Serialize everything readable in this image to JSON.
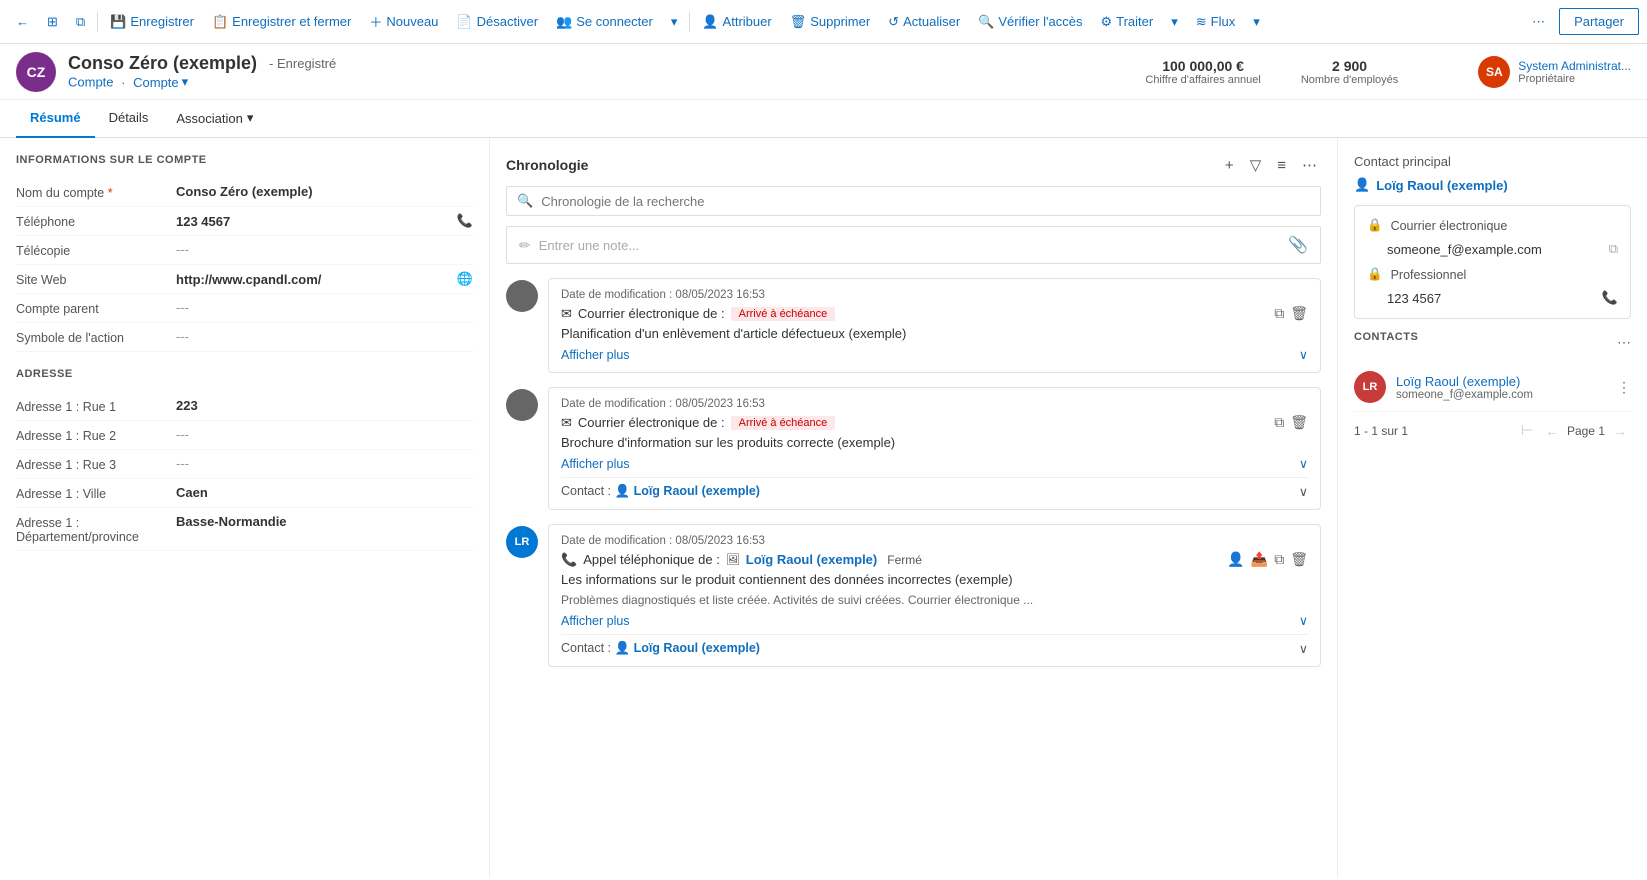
{
  "toolbar": {
    "back_icon": "←",
    "grid_icon": "⊞",
    "window_icon": "⧉",
    "save_label": "Enregistrer",
    "save_close_label": "Enregistrer et fermer",
    "new_label": "Nouveau",
    "deactivate_label": "Désactiver",
    "connect_label": "Se connecter",
    "connect_dropdown": "▾",
    "assign_label": "Attribuer",
    "delete_label": "Supprimer",
    "refresh_label": "Actualiser",
    "verify_label": "Vérifier l'accès",
    "process_label": "Traiter",
    "process_dropdown": "▾",
    "flux_label": "Flux",
    "flux_dropdown": "▾",
    "more_icon": "⋯",
    "share_label": "Partager"
  },
  "record": {
    "initials": "CZ",
    "name": "Conso Zéro (exemple)",
    "status": "- Enregistré",
    "breadcrumb1": "Compte",
    "breadcrumb2": "Compte",
    "kpi1_value": "100 000,00 €",
    "kpi1_label": "Chiffre d'affaires annuel",
    "kpi2_value": "2 900",
    "kpi2_label": "Nombre d'employés",
    "owner_initials": "SA",
    "owner_name": "System Administrat...",
    "owner_label": "Propriétaire"
  },
  "tabs": {
    "tab1": "Résumé",
    "tab2": "Détails",
    "tab3": "Association"
  },
  "account_info": {
    "section_title": "INFORMATIONS SUR LE COMPTE",
    "fields": [
      {
        "label": "Nom du compte",
        "required": true,
        "value": "Conso Zéro (exemple)",
        "empty": false
      },
      {
        "label": "Téléphone",
        "required": false,
        "value": "123 4567",
        "empty": false,
        "icon": "📞"
      },
      {
        "label": "Télécopie",
        "required": false,
        "value": "---",
        "empty": true
      },
      {
        "label": "Site Web",
        "required": false,
        "value": "http://www.cpandl.com/",
        "empty": false,
        "icon": "🌐"
      },
      {
        "label": "Compte parent",
        "required": false,
        "value": "---",
        "empty": true
      },
      {
        "label": "Symbole de l'action",
        "required": false,
        "value": "---",
        "empty": true
      }
    ]
  },
  "address": {
    "section_title": "ADRESSE",
    "fields": [
      {
        "label": "Adresse 1 : Rue 1",
        "value": "223",
        "empty": false
      },
      {
        "label": "Adresse 1 : Rue 2",
        "value": "---",
        "empty": true
      },
      {
        "label": "Adresse 1 : Rue 3",
        "value": "---",
        "empty": true
      },
      {
        "label": "Adresse 1 : Ville",
        "value": "Caen",
        "empty": false
      },
      {
        "label": "Adresse 1 : Département/province",
        "value": "Basse-Normandie",
        "empty": false
      }
    ]
  },
  "timeline": {
    "title": "Chronologie",
    "search_placeholder": "Chronologie de la recherche",
    "note_placeholder": "Entrer une note...",
    "add_icon": "+",
    "filter_icon": "⛁",
    "list_icon": "≡",
    "more_icon": "⋯",
    "entries": [
      {
        "id": 1,
        "avatar": "",
        "avatar_type": "grey",
        "date": "Date de modification : 08/05/2023 16:53",
        "type_icon": "✉",
        "type_label": "Courrier électronique de :",
        "badge": "Arrivé à échéance",
        "description": "Planification d'un enlèvement d'article défectueux (exemple)",
        "show_more": "Afficher plus",
        "contact": null
      },
      {
        "id": 2,
        "avatar": "",
        "avatar_type": "grey",
        "date": "Date de modification : 08/05/2023 16:53",
        "type_icon": "✉",
        "type_label": "Courrier électronique de :",
        "badge": "Arrivé à échéance",
        "description": "Brochure d'information sur les produits correcte (exemple)",
        "show_more": "Afficher plus",
        "contact": "Loïg Raoul (exemple)"
      },
      {
        "id": 3,
        "avatar": "LR",
        "avatar_type": "blue",
        "date": "Date de modification : 08/05/2023 16:53",
        "type_icon": "📞",
        "type_label": "Appel téléphonique de :",
        "person_icon": "👤",
        "person_label": "Loïg Raoul (exemple)",
        "status_badge": "Fermé",
        "description": "Les informations sur le produit contiennent des données incorrectes (exemple)",
        "description2": "Problèmes diagnostiqués et liste créée. Activités de suivi créées. Courrier électronique ...",
        "show_more": "Afficher plus",
        "contact": "Loïg Raoul (exemple)"
      }
    ]
  },
  "right_panel": {
    "contact_principal_title": "Contact principal",
    "contact_principal_name": "Loïg Raoul (exemple)",
    "email_icon": "🔒",
    "email_label": "Courrier électronique",
    "email_value": "someone_f@example.com",
    "phone_icon": "🔒",
    "phone_label": "Professionnel",
    "phone_value": "123 4567",
    "contacts_title": "CONTACTS",
    "contacts": [
      {
        "initials": "LR",
        "name": "Loïg Raoul (exemple)",
        "email": "someone_f@example.com"
      }
    ],
    "pagination_info": "1 - 1 sur 1",
    "pagination_page": "Page 1"
  }
}
